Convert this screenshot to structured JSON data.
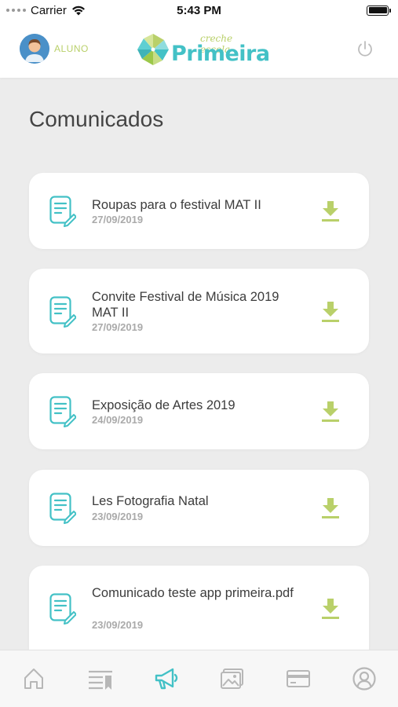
{
  "status_bar": {
    "carrier": "Carrier",
    "time": "5:43 PM"
  },
  "header": {
    "user_label": "ALUNO",
    "logo_subtitle": "creche escola",
    "logo_title": "Primeira",
    "icons": {
      "avatar": "student-avatar",
      "logo": "pinwheel-logo",
      "power": "power-icon"
    }
  },
  "page": {
    "title": "Comunicados"
  },
  "comunicados": [
    {
      "title": "Roupas para o festival MAT II",
      "date": "27/09/2019"
    },
    {
      "title": "Convite Festival de Música 2019 MAT II",
      "date": "27/09/2019"
    },
    {
      "title": "Exposição de Artes 2019",
      "date": "24/09/2019"
    },
    {
      "title": "Les Fotografia Natal",
      "date": "23/09/2019"
    },
    {
      "title": "Comunicado teste app primeira.pdf",
      "date": "23/09/2019"
    }
  ],
  "bottom_nav": [
    {
      "icon": "home-icon",
      "active": false
    },
    {
      "icon": "agenda-icon",
      "active": false
    },
    {
      "icon": "megaphone-icon",
      "active": true
    },
    {
      "icon": "gallery-icon",
      "active": false
    },
    {
      "icon": "card-icon",
      "active": false
    },
    {
      "icon": "profile-icon",
      "active": false
    }
  ],
  "colors": {
    "accent_teal": "#43c1c6",
    "accent_lime": "#b9d06a",
    "inactive_icon": "#b7b7b7",
    "background": "#ececec"
  }
}
